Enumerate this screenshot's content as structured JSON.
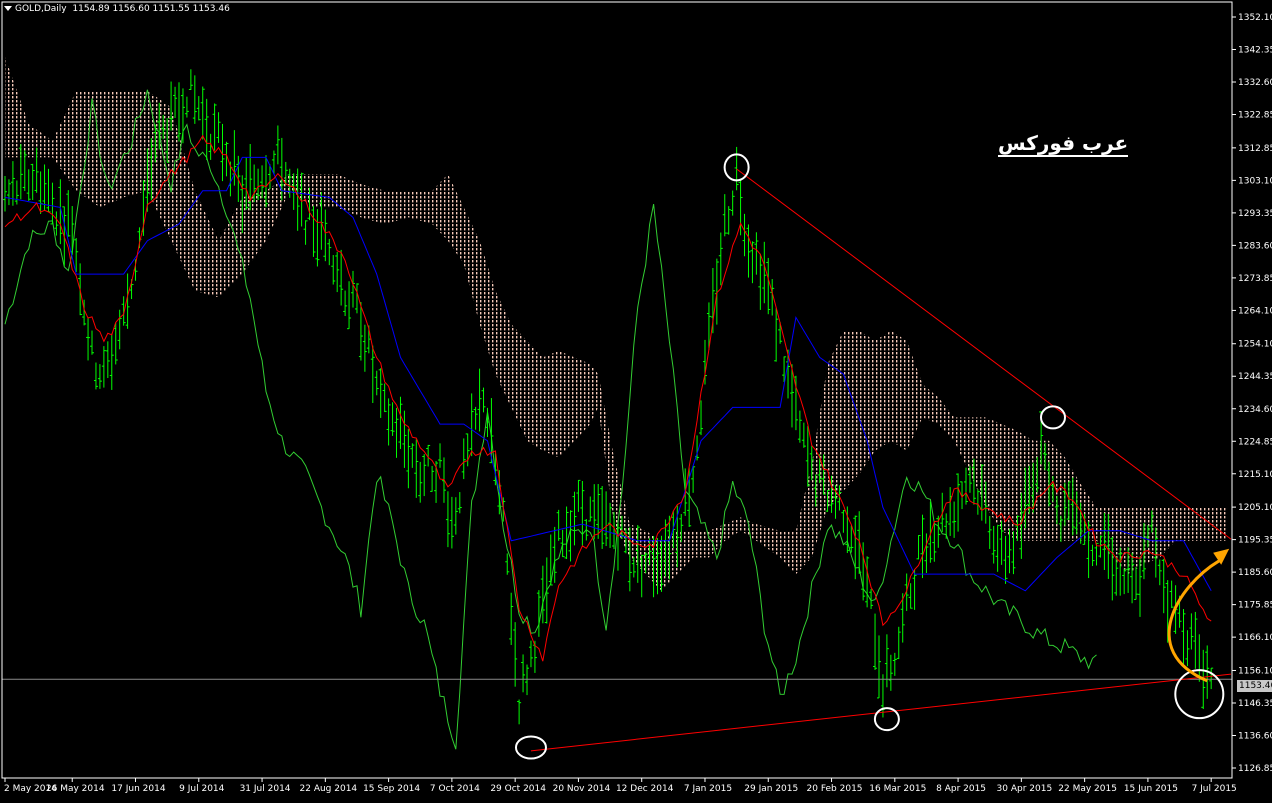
{
  "header": {
    "symbol": "GOLD,Daily",
    "ohlc": "1154.89 1156.60 1151.55 1153.46"
  },
  "watermark": "عرب فوركس",
  "current_price_label": "1153.46",
  "colors": {
    "background": "#000000",
    "price_bars": "#00ff00",
    "chikou": "#32cd32",
    "tenkan": "#ff0000",
    "kijun": "#0000ff",
    "cloud": "#f5c9b8",
    "trendline": "#ff0000",
    "marker_circle": "#ffffff",
    "arrow": "#ffa500",
    "axis_text": "#ffffff"
  },
  "chart_data": {
    "type": "line",
    "title": "GOLD,Daily",
    "ylim": [
      1126.85,
      1352.1
    ],
    "y_ticks": [
      "1352.10",
      "1342.35",
      "1332.60",
      "1322.85",
      "1312.85",
      "1303.10",
      "1293.35",
      "1283.60",
      "1273.85",
      "1264.10",
      "1254.10",
      "1244.35",
      "1234.60",
      "1224.85",
      "1215.10",
      "1205.10",
      "1195.35",
      "1185.60",
      "1175.85",
      "1166.10",
      "1156.10",
      "1146.35",
      "1136.60",
      "1126.85"
    ],
    "x_ticks": [
      "2 May 2014",
      "26 May 2014",
      "17 Jun 2014",
      "9 Jul 2014",
      "31 Jul 2014",
      "22 Aug 2014",
      "15 Sep 2014",
      "7 Oct 2014",
      "29 Oct 2014",
      "20 Nov 2014",
      "12 Dec 2014",
      "7 Jan 2015",
      "29 Jan 2015",
      "20 Feb 2015",
      "16 Mar 2015",
      "8 Apr 2015",
      "30 Apr 2015",
      "22 May 2015",
      "15 Jun 2015",
      "7 Jul 2015"
    ],
    "x_tick_index": [
      0,
      17,
      33,
      49,
      65,
      81,
      97,
      113,
      129,
      145,
      161,
      177,
      193,
      209,
      225,
      241,
      257,
      273,
      289,
      305
    ],
    "bars_count": 310,
    "price_keypoints": [
      [
        0,
        1298
      ],
      [
        8,
        1305
      ],
      [
        14,
        1292
      ],
      [
        17,
        1290
      ],
      [
        22,
        1250
      ],
      [
        25,
        1244
      ],
      [
        30,
        1262
      ],
      [
        33,
        1278
      ],
      [
        38,
        1315
      ],
      [
        43,
        1322
      ],
      [
        46,
        1330
      ],
      [
        49,
        1325
      ],
      [
        52,
        1318
      ],
      [
        56,
        1312
      ],
      [
        60,
        1298
      ],
      [
        65,
        1306
      ],
      [
        70,
        1310
      ],
      [
        73,
        1296
      ],
      [
        78,
        1290
      ],
      [
        82,
        1285
      ],
      [
        86,
        1270
      ],
      [
        90,
        1262
      ],
      [
        95,
        1235
      ],
      [
        100,
        1228
      ],
      [
        105,
        1215
      ],
      [
        110,
        1218
      ],
      [
        113,
        1200
      ],
      [
        117,
        1220
      ],
      [
        121,
        1240
      ],
      [
        126,
        1200
      ],
      [
        130,
        1148
      ],
      [
        133,
        1160
      ],
      [
        136,
        1175
      ],
      [
        140,
        1195
      ],
      [
        145,
        1205
      ],
      [
        150,
        1200
      ],
      [
        155,
        1198
      ],
      [
        160,
        1188
      ],
      [
        165,
        1190
      ],
      [
        170,
        1200
      ],
      [
        174,
        1215
      ],
      [
        178,
        1255
      ],
      [
        182,
        1290
      ],
      [
        185,
        1305
      ],
      [
        188,
        1285
      ],
      [
        192,
        1275
      ],
      [
        196,
        1255
      ],
      [
        200,
        1232
      ],
      [
        204,
        1215
      ],
      [
        208,
        1210
      ],
      [
        212,
        1205
      ],
      [
        216,
        1192
      ],
      [
        220,
        1168
      ],
      [
        222,
        1152
      ],
      [
        225,
        1160
      ],
      [
        228,
        1175
      ],
      [
        232,
        1195
      ],
      [
        236,
        1200
      ],
      [
        240,
        1205
      ],
      [
        244,
        1215
      ],
      [
        248,
        1205
      ],
      [
        252,
        1190
      ],
      [
        256,
        1195
      ],
      [
        260,
        1215
      ],
      [
        263,
        1225
      ],
      [
        266,
        1200
      ],
      [
        270,
        1210
      ],
      [
        274,
        1195
      ],
      [
        278,
        1195
      ],
      [
        282,
        1185
      ],
      [
        286,
        1180
      ],
      [
        290,
        1198
      ],
      [
        294,
        1178
      ],
      [
        298,
        1170
      ],
      [
        302,
        1160
      ],
      [
        305,
        1153
      ]
    ],
    "tenkan_keypoints": [
      [
        0,
        1290
      ],
      [
        8,
        1295
      ],
      [
        14,
        1290
      ],
      [
        20,
        1265
      ],
      [
        25,
        1255
      ],
      [
        30,
        1262
      ],
      [
        36,
        1296
      ],
      [
        42,
        1305
      ],
      [
        50,
        1315
      ],
      [
        56,
        1310
      ],
      [
        62,
        1298
      ],
      [
        70,
        1305
      ],
      [
        78,
        1293
      ],
      [
        86,
        1280
      ],
      [
        94,
        1250
      ],
      [
        100,
        1232
      ],
      [
        106,
        1222
      ],
      [
        112,
        1210
      ],
      [
        118,
        1222
      ],
      [
        124,
        1222
      ],
      [
        130,
        1175
      ],
      [
        136,
        1160
      ],
      [
        140,
        1182
      ],
      [
        146,
        1192
      ],
      [
        152,
        1200
      ],
      [
        158,
        1195
      ],
      [
        164,
        1194
      ],
      [
        172,
        1210
      ],
      [
        180,
        1268
      ],
      [
        186,
        1290
      ],
      [
        192,
        1278
      ],
      [
        198,
        1250
      ],
      [
        204,
        1225
      ],
      [
        210,
        1210
      ],
      [
        216,
        1195
      ],
      [
        222,
        1170
      ],
      [
        228,
        1180
      ],
      [
        234,
        1198
      ],
      [
        240,
        1210
      ],
      [
        248,
        1205
      ],
      [
        256,
        1200
      ],
      [
        264,
        1212
      ],
      [
        270,
        1208
      ],
      [
        276,
        1195
      ],
      [
        282,
        1190
      ],
      [
        290,
        1192
      ],
      [
        298,
        1185
      ],
      [
        305,
        1170
      ]
    ],
    "kijun_keypoints": [
      [
        0,
        1298
      ],
      [
        14,
        1295
      ],
      [
        18,
        1275
      ],
      [
        30,
        1275
      ],
      [
        36,
        1285
      ],
      [
        44,
        1290
      ],
      [
        50,
        1300
      ],
      [
        56,
        1300
      ],
      [
        60,
        1310
      ],
      [
        66,
        1310
      ],
      [
        70,
        1300
      ],
      [
        82,
        1298
      ],
      [
        88,
        1292
      ],
      [
        94,
        1275
      ],
      [
        100,
        1250
      ],
      [
        110,
        1230
      ],
      [
        116,
        1230
      ],
      [
        122,
        1225
      ],
      [
        128,
        1195
      ],
      [
        146,
        1200
      ],
      [
        160,
        1195
      ],
      [
        168,
        1195
      ],
      [
        176,
        1225
      ],
      [
        184,
        1235
      ],
      [
        190,
        1235
      ],
      [
        196,
        1235
      ],
      [
        200,
        1262
      ],
      [
        206,
        1250
      ],
      [
        212,
        1245
      ],
      [
        218,
        1225
      ],
      [
        222,
        1205
      ],
      [
        230,
        1185
      ],
      [
        240,
        1185
      ],
      [
        250,
        1185
      ],
      [
        258,
        1180
      ],
      [
        266,
        1190
      ],
      [
        274,
        1198
      ],
      [
        282,
        1198
      ],
      [
        290,
        1195
      ],
      [
        298,
        1195
      ],
      [
        305,
        1180
      ]
    ],
    "chikou_keypoints": [
      [
        0,
        1260
      ],
      [
        6,
        1285
      ],
      [
        12,
        1290
      ],
      [
        16,
        1275
      ],
      [
        22,
        1325
      ],
      [
        26,
        1300
      ],
      [
        32,
        1315
      ],
      [
        36,
        1330
      ],
      [
        42,
        1302
      ],
      [
        46,
        1320
      ],
      [
        48,
        1312
      ],
      [
        52,
        1308
      ],
      [
        56,
        1295
      ],
      [
        62,
        1268
      ],
      [
        66,
        1240
      ],
      [
        70,
        1225
      ],
      [
        76,
        1215
      ],
      [
        82,
        1200
      ],
      [
        86,
        1190
      ],
      [
        90,
        1175
      ],
      [
        94,
        1215
      ],
      [
        98,
        1200
      ],
      [
        102,
        1180
      ],
      [
        106,
        1170
      ],
      [
        110,
        1150
      ],
      [
        114,
        1135
      ],
      [
        118,
        1205
      ],
      [
        122,
        1235
      ],
      [
        126,
        1200
      ],
      [
        130,
        1175
      ],
      [
        134,
        1168
      ],
      [
        138,
        1185
      ],
      [
        142,
        1195
      ],
      [
        148,
        1200
      ],
      [
        152,
        1170
      ],
      [
        156,
        1210
      ],
      [
        160,
        1265
      ],
      [
        164,
        1295
      ],
      [
        168,
        1255
      ],
      [
        172,
        1210
      ],
      [
        176,
        1200
      ],
      [
        180,
        1190
      ],
      [
        184,
        1212
      ],
      [
        188,
        1200
      ],
      [
        192,
        1170
      ],
      [
        196,
        1148
      ],
      [
        200,
        1160
      ],
      [
        204,
        1180
      ],
      [
        208,
        1200
      ],
      [
        212,
        1195
      ],
      [
        216,
        1185
      ],
      [
        220,
        1175
      ],
      [
        224,
        1195
      ],
      [
        228,
        1215
      ],
      [
        232,
        1210
      ],
      [
        236,
        1200
      ],
      [
        240,
        1195
      ],
      [
        244,
        1185
      ],
      [
        248,
        1180
      ],
      [
        252,
        1175
      ],
      [
        256,
        1172
      ],
      [
        260,
        1168
      ],
      [
        264,
        1165
      ],
      [
        268,
        1163
      ],
      [
        272,
        1160
      ],
      [
        276,
        1158
      ]
    ],
    "cloud_spans": [
      [
        0,
        1310,
        1340
      ],
      [
        6,
        1310,
        1320
      ],
      [
        12,
        1310,
        1315
      ],
      [
        18,
        1300,
        1330
      ],
      [
        24,
        1295,
        1330
      ],
      [
        30,
        1298,
        1330
      ],
      [
        36,
        1300,
        1330
      ],
      [
        42,
        1285,
        1325
      ],
      [
        48,
        1270,
        1300
      ],
      [
        54,
        1268,
        1285
      ],
      [
        60,
        1275,
        1298
      ],
      [
        66,
        1285,
        1300
      ],
      [
        72,
        1300,
        1305
      ],
      [
        78,
        1295,
        1305
      ],
      [
        84,
        1295,
        1305
      ],
      [
        90,
        1292,
        1302
      ],
      [
        96,
        1290,
        1300
      ],
      [
        102,
        1292,
        1300
      ],
      [
        108,
        1290,
        1300
      ],
      [
        112,
        1285,
        1305
      ],
      [
        116,
        1278,
        1295
      ],
      [
        120,
        1260,
        1285
      ],
      [
        124,
        1245,
        1270
      ],
      [
        128,
        1235,
        1260
      ],
      [
        132,
        1225,
        1255
      ],
      [
        136,
        1222,
        1250
      ],
      [
        140,
        1220,
        1252
      ],
      [
        144,
        1225,
        1250
      ],
      [
        148,
        1230,
        1248
      ],
      [
        150,
        1235,
        1245
      ],
      [
        154,
        1200,
        1220
      ],
      [
        158,
        1190,
        1200
      ],
      [
        162,
        1185,
        1198
      ],
      [
        166,
        1180,
        1195
      ],
      [
        170,
        1185,
        1198
      ],
      [
        174,
        1190,
        1198
      ],
      [
        178,
        1190,
        1198
      ],
      [
        182,
        1195,
        1200
      ],
      [
        186,
        1198,
        1202
      ],
      [
        190,
        1195,
        1200
      ],
      [
        196,
        1190,
        1198
      ],
      [
        200,
        1185,
        1198
      ],
      [
        204,
        1190,
        1218
      ],
      [
        208,
        1205,
        1248
      ],
      [
        212,
        1210,
        1258
      ],
      [
        216,
        1215,
        1258
      ],
      [
        220,
        1222,
        1255
      ],
      [
        224,
        1225,
        1258
      ],
      [
        228,
        1222,
        1255
      ],
      [
        232,
        1232,
        1242
      ],
      [
        236,
        1230,
        1238
      ],
      [
        240,
        1225,
        1232
      ],
      [
        244,
        1215,
        1232
      ],
      [
        248,
        1205,
        1232
      ],
      [
        252,
        1198,
        1230
      ],
      [
        256,
        1195,
        1228
      ],
      [
        260,
        1195,
        1225
      ],
      [
        264,
        1195,
        1225
      ],
      [
        268,
        1195,
        1220
      ],
      [
        272,
        1195,
        1212
      ],
      [
        276,
        1195,
        1205
      ],
      [
        280,
        1190,
        1205
      ],
      [
        284,
        1185,
        1205
      ],
      [
        288,
        1188,
        1205
      ],
      [
        292,
        1190,
        1205
      ],
      [
        296,
        1195,
        1205
      ],
      [
        300,
        1195,
        1205
      ],
      [
        305,
        1195,
        1205
      ],
      [
        310,
        1195,
        1205
      ]
    ],
    "current_price": 1153.46,
    "trendlines": [
      {
        "from": [
          185,
          1306.5
        ],
        "to": [
          310,
          1195.5
        ]
      },
      {
        "from": [
          133,
          1132.0
        ],
        "to": [
          310,
          1155.0
        ]
      }
    ],
    "highlight_circles": [
      [
        185,
        1307
      ],
      [
        133,
        1133
      ],
      [
        223,
        1141.5
      ],
      [
        265,
        1232
      ],
      [
        302,
        1149
      ]
    ],
    "grid": false,
    "legend": "none"
  }
}
